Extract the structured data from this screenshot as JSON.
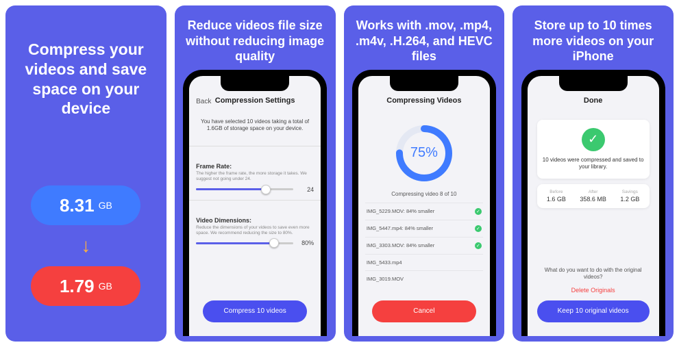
{
  "panel1": {
    "title": "Compress your videos and save space on your device",
    "before": "8.31",
    "after": "1.79",
    "unit": "GB"
  },
  "panel2": {
    "title": "Reduce videos file size without reducing image quality",
    "nav_back": "Back",
    "nav_title": "Compression Settings",
    "subtext": "You have selected 10 videos taking a total of 1.6GB of storage space on your device.",
    "frame_label": "Frame Rate:",
    "frame_hint": "The higher the frame rate, the more storage it takes. We suggest not going under 24.",
    "frame_value": "24",
    "dim_label": "Video Dimensions:",
    "dim_hint": "Reduce the dimensions of your videos to save even more space. We recommend reducing the size to 80%.",
    "dim_value": "80%",
    "button": "Compress 10 videos"
  },
  "panel3": {
    "title": "Works with .mov, .mp4, .m4v, .H.264, and HEVC files",
    "nav_title": "Compressing Videos",
    "percent": "75%",
    "progress_label": "Compressing video 8 of 10",
    "files": [
      {
        "name": "IMG_5229.MOV: 84% smaller",
        "done": true
      },
      {
        "name": "IMG_5447.mp4: 84% smaller",
        "done": true
      },
      {
        "name": "IMG_3303.MOV: 84% smaller",
        "done": true
      },
      {
        "name": "IMG_5433.mp4",
        "done": false
      },
      {
        "name": "IMG_3019.MOV",
        "done": false
      }
    ],
    "button": "Cancel"
  },
  "panel4": {
    "title": "Store up to 10 times more videos on your iPhone",
    "nav_title": "Done",
    "done_msg": "10 videos were compressed and saved to your library.",
    "stats": {
      "before_label": "Before",
      "before_val": "1.6 GB",
      "after_label": "After",
      "after_val": "358.6 MB",
      "savings_label": "Savings",
      "savings_val": "1.2 GB"
    },
    "question": "What do you want to do with the original videos?",
    "delete": "Delete Originals",
    "keep": "Keep 10 original videos"
  }
}
